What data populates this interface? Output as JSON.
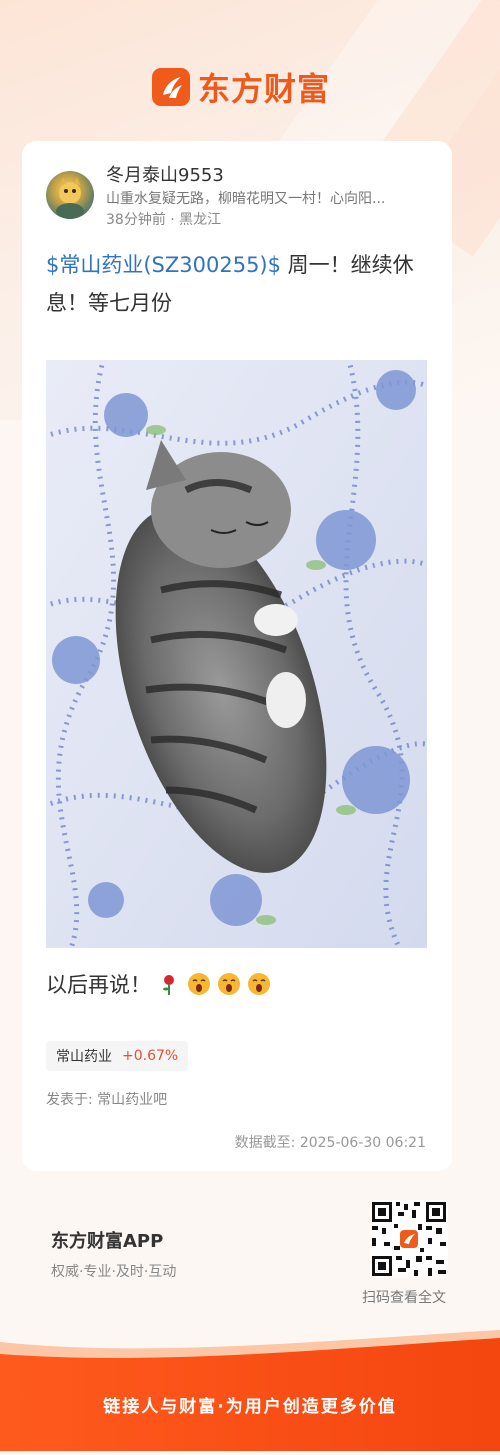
{
  "brand": {
    "logo_text": "东方财富",
    "accent": "#ef5a1c"
  },
  "post": {
    "username": "冬月泰山9553",
    "signature": "山重水复疑无路，柳暗花明又一村！心向阳...",
    "meta": "38分钟前 · 黑龙江",
    "stock_link": "$常山药业(SZ300255)$",
    "text": " 周一！继续休息！等七月份",
    "footer_text": "以后再说！",
    "emojis": [
      "rose-icon",
      "yawn-face-icon",
      "yawn-face-icon",
      "yawn-face-icon"
    ]
  },
  "stock_tag": {
    "name": "常山药业",
    "change": "+0.67%",
    "change_color": "#e94d35"
  },
  "posted_in": "发表于: 常山药业吧",
  "data_time": "数据截至: 2025-06-30 06:21",
  "app": {
    "name": "东方财富APP",
    "tagline": "权威·专业·及时·互动",
    "qr_caption": "扫码查看全文"
  },
  "slogan": "链接人与财富·为用户创造更多价值"
}
